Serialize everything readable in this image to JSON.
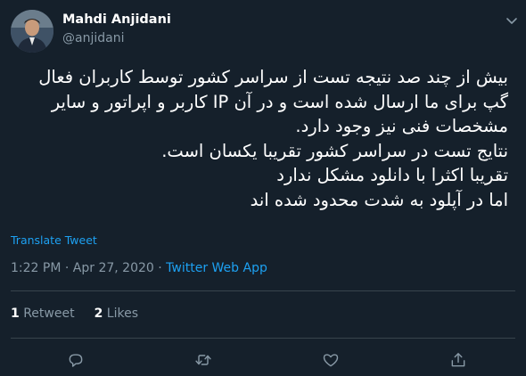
{
  "author": {
    "name": "Mahdi Anjidani",
    "handle": "@anjidani"
  },
  "tweet": {
    "text": "بیش از چند صد نتیجه تست از سراسر کشور توسط کاربران فعال گپ برای ما ارسال شده است و در آن IP کاربر و اپراتور و سایر مشخصات فنی نیز وجود دارد.\nنتایج تست در سراسر کشور تقریبا یکسان است.\nتقریبا اکثرا با دانلود مشکل ندارد\nاما در آپلود به شدت محدود شده اند",
    "translate_label": "Translate Tweet",
    "time": "1:22 PM",
    "separator": "·",
    "date": "Apr 27, 2020",
    "source": "Twitter Web App"
  },
  "stats": {
    "retweets_count": "1",
    "retweets_label": "Retweet",
    "likes_count": "2",
    "likes_label": "Likes"
  },
  "colors": {
    "background": "#15202b",
    "accent": "#1da1f2",
    "muted": "#8899a6",
    "divider": "#38444d"
  },
  "icons": [
    "chevron-down-icon",
    "reply-icon",
    "retweet-icon",
    "like-icon",
    "share-icon"
  ]
}
